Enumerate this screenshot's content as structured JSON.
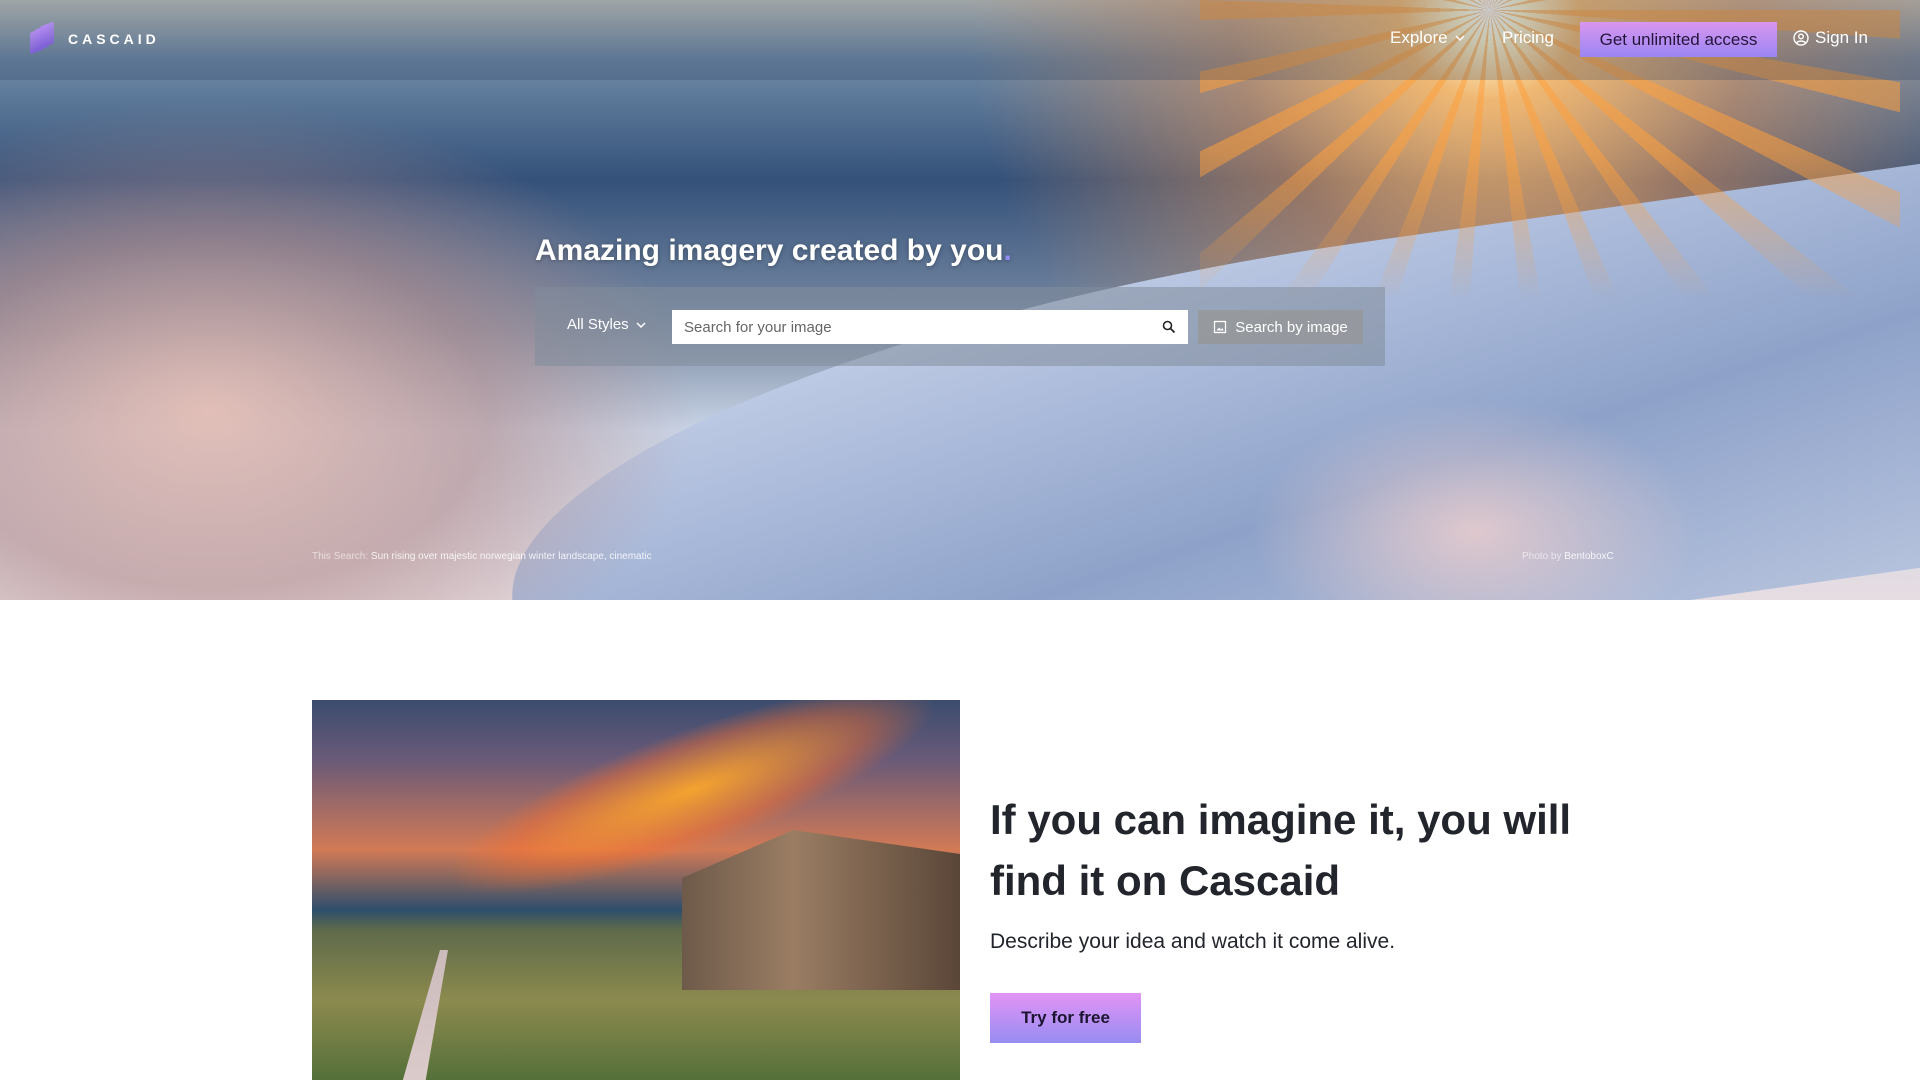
{
  "nav": {
    "brand": "CASCAID",
    "explore": "Explore",
    "pricing": "Pricing",
    "cta": "Get unlimited access",
    "sign_in": "Sign In"
  },
  "hero": {
    "headline": "Amazing imagery created by you",
    "headline_dot": ".",
    "styles_label": "All Styles",
    "search_placeholder": "Search for your image",
    "search_by_image": "Search by image",
    "caption_prefix": "This Search:",
    "caption_text": "Sun rising over majestic norwegian winter landscape, cinematic",
    "credit_prefix": "Photo by",
    "credit_name": "BentoboxC"
  },
  "feature": {
    "heading": "If you can imagine it, you will find it on Cascaid",
    "description": "Describe your idea and watch it come alive.",
    "button": "Try for free"
  },
  "colors": {
    "accent_top": "#d996ef",
    "accent_bottom": "#9a86f3",
    "text": "#22252b"
  }
}
